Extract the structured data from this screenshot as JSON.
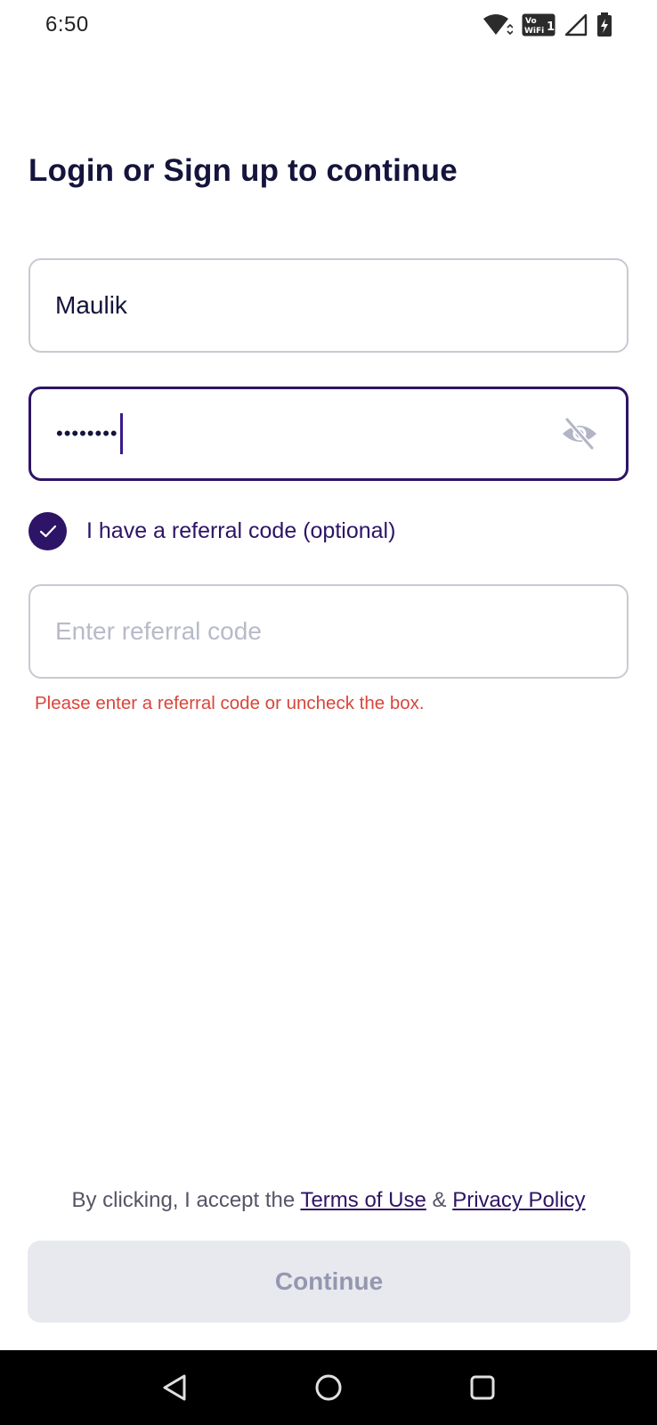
{
  "status_bar": {
    "time": "6:50",
    "icons": [
      "wifi-icon",
      "vowifi-icon",
      "signal-icon",
      "battery-charging-icon"
    ],
    "vowifi_top": "Vo",
    "vowifi_bottom": "WiFi",
    "vowifi_num": "1"
  },
  "title": "Login or Sign up to continue",
  "username": {
    "value": "Maulik"
  },
  "password": {
    "masked_value": "••••••••",
    "toggle_icon": "eye-off-icon"
  },
  "referral": {
    "checkbox_label": "I have a referral code (optional)",
    "checked": true,
    "placeholder": "Enter referral code",
    "error": "Please enter a referral code or uncheck the box."
  },
  "footer": {
    "terms_prefix": "By clicking, I accept the",
    "terms_link": "Terms of Use",
    "ampersand": "&",
    "privacy_link": "Privacy Policy",
    "continue_label": "Continue"
  },
  "nav": {
    "icons": [
      "back-icon",
      "home-icon",
      "recents-icon"
    ]
  },
  "colors": {
    "primary": "#2e1466",
    "title": "#14143c",
    "error": "#d9453a",
    "disabled_bg": "#e8e9ef",
    "disabled_text": "#9597b0"
  }
}
